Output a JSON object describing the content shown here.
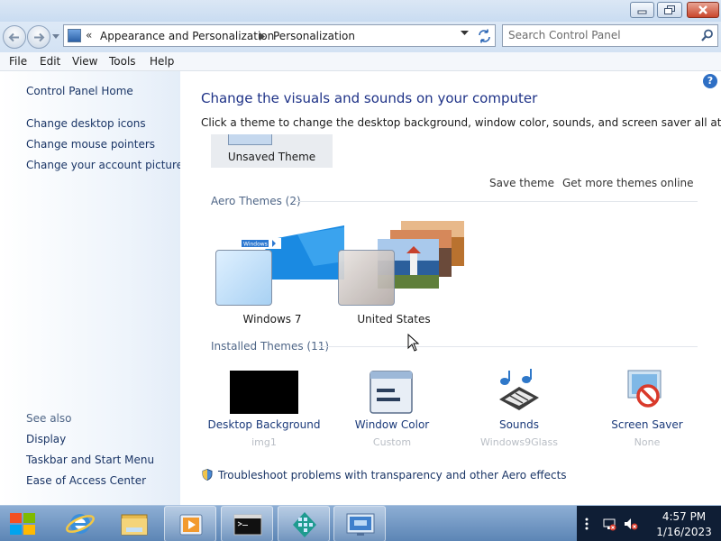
{
  "address": {
    "history_chevron": "«",
    "crumbs": [
      "Appearance and Personalization",
      "Personalization"
    ]
  },
  "search": {
    "placeholder": "Search Control Panel"
  },
  "menu": {
    "items": [
      "File",
      "Edit",
      "View",
      "Tools",
      "Help"
    ]
  },
  "sidebar": {
    "home": "Control Panel Home",
    "links": [
      "Change desktop icons",
      "Change mouse pointers",
      "Change your account picture"
    ],
    "see_also_heading": "See also",
    "see_also": [
      "Display",
      "Taskbar and Start Menu",
      "Ease of Access Center"
    ]
  },
  "main": {
    "title": "Change the visuals and sounds on your computer",
    "subtitle": "Click a theme to change the desktop background, window color, sounds, and screen saver all at once.",
    "help_glyph": "?",
    "unsaved_theme": "Unsaved Theme",
    "save_theme": "Save theme",
    "get_more": "Get more themes online",
    "aero_heading": "Aero Themes (2)",
    "installed_heading": "Installed Themes (11)",
    "themes": [
      "Windows 7",
      "United States"
    ],
    "win7_banner": "Windows 8",
    "settings": [
      {
        "label": "Desktop Background",
        "value": "img1",
        "icon": "desktop-background-icon"
      },
      {
        "label": "Window Color",
        "value": "Custom",
        "icon": "window-color-icon"
      },
      {
        "label": "Sounds",
        "value": "Windows9Glass",
        "icon": "sounds-icon"
      },
      {
        "label": "Screen Saver",
        "value": "None",
        "icon": "screen-saver-icon"
      }
    ],
    "troubleshoot": "Troubleshoot problems with transparency and other Aero effects"
  },
  "taskbar": {
    "apps": [
      "internet-explorer-icon",
      "file-explorer-icon",
      "media-player-icon",
      "command-prompt-icon",
      "app-icon",
      "control-panel-icon"
    ],
    "time": "4:57 PM",
    "date": "1/16/2023"
  },
  "colors": {
    "title_blue": "#1e3287",
    "link_blue": "#1a3566",
    "accent": "#2e6fc4"
  }
}
